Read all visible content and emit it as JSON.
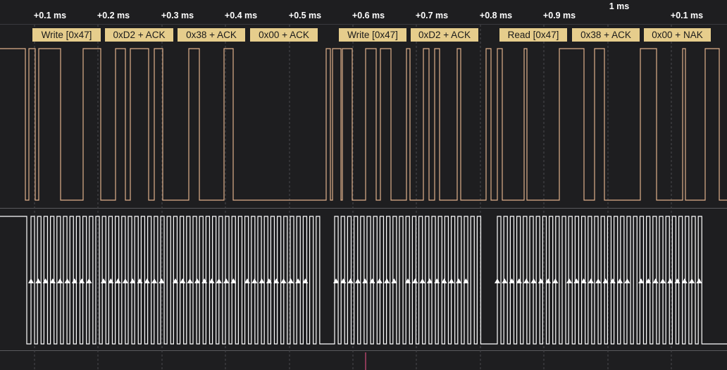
{
  "ruler": {
    "ticks": [
      "+0.1 ms",
      "+0.2 ms",
      "+0.3 ms",
      "+0.4 ms",
      "+0.5 ms",
      "+0.6 ms",
      "+0.7 ms",
      "+0.8 ms",
      "+0.9 ms",
      "+0.1 ms"
    ],
    "major_label": "1 ms"
  },
  "decode": [
    "Write [0x47]",
    "0xD2 + ACK",
    "0x38 + ACK",
    "0x00 + ACK",
    "Write [0x47]",
    "0xD2 + ACK",
    "Read [0x47]",
    "0x38 + ACK",
    "0x00 + NAK"
  ],
  "colors": {
    "background": "#1e1e20",
    "sda_trace": "#e0b08a",
    "scl_trace": "#ffffff",
    "decode_bg": "#e6cd8c",
    "decode_text": "#1a1a1a",
    "grid": "#4a4a4e",
    "cursor": "#8a3a56"
  },
  "icons": {
    "clock_edge": "rising-edge-arrow-icon"
  }
}
